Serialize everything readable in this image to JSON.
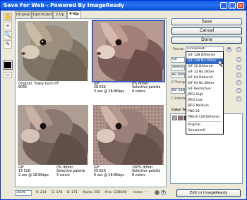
{
  "window": {
    "title": "Save For Web - Powered By ImageReady",
    "minimize": "_",
    "maximize": "□",
    "close": "×"
  },
  "tools": [
    {
      "name": "hand-tool-icon",
      "glyph": "✋"
    },
    {
      "name": "slice-select-tool-icon",
      "glyph": "⌖"
    },
    {
      "name": "zoom-tool-icon",
      "glyph": "🔍"
    },
    {
      "name": "eyedropper-tool-icon",
      "glyph": "✎"
    },
    {
      "name": "toggle-slices-icon",
      "glyph": "▭"
    }
  ],
  "tabs": [
    "Original",
    "Optimized",
    "2-Up",
    "4-Up"
  ],
  "panes": [
    {
      "left": "Original: \"baby bunn.tif\"",
      "left2": "805K",
      "left3": "",
      "right": "",
      "right2": "",
      "right3": ""
    },
    {
      "left": "GIF",
      "left2": "28.53K",
      "left3": "3 sec @ 28.8Kbps",
      "right": "0% dither",
      "right2": "Selective palette",
      "right3": "8 colors"
    },
    {
      "left": "GIF",
      "left2": "17.52K",
      "left3": "2 sec @ 28.8Kbps",
      "right": "0% dither",
      "right2": "Selective palette",
      "right3": "4 colors"
    },
    {
      "left": "GIF",
      "left2": "50.62K",
      "left3": "9 sec @ 28.8Kbps",
      "right": "100% dither",
      "right2": "Selective palette",
      "right3": "8 colors"
    }
  ],
  "buttons": {
    "save": "Save",
    "cancel": "Cancel",
    "done": "Done",
    "edit": "Edit in ImageReady"
  },
  "settings": {
    "preset_label": "Preset:",
    "preset_value": "[Unnamed]",
    "format": "GIF",
    "selective": "Selective",
    "no_dither": "No Dither",
    "transparency": "Transpa",
    "no_transp": "No Transp",
    "interlaced": "Interlac",
    "color_table": "Color Ta"
  },
  "preset_options": [
    "[Unnamed]",
    "GIF 128 Dithered",
    "GIF 128 No Dither",
    "GIF 32 Dithered",
    "GIF 32 No Dither",
    "GIF 64 Dithered",
    "GIF 64 No Dither",
    "GIF Restrictive",
    "JPEG High",
    "JPEG Low",
    "JPEG Medium",
    "PNG-24",
    "PNG-8 128 Dithered",
    "Original",
    "[Unnamed]"
  ],
  "status": {
    "zoom": "100%",
    "r": "R: 214",
    "g": "G: 178",
    "b": "B: 171",
    "alpha": "Alpha: 255",
    "hex": "Hex: C2B0AB",
    "index": "Index: --"
  },
  "colors": {
    "title": "#0a5fe9",
    "highlight": "#316ac5"
  }
}
